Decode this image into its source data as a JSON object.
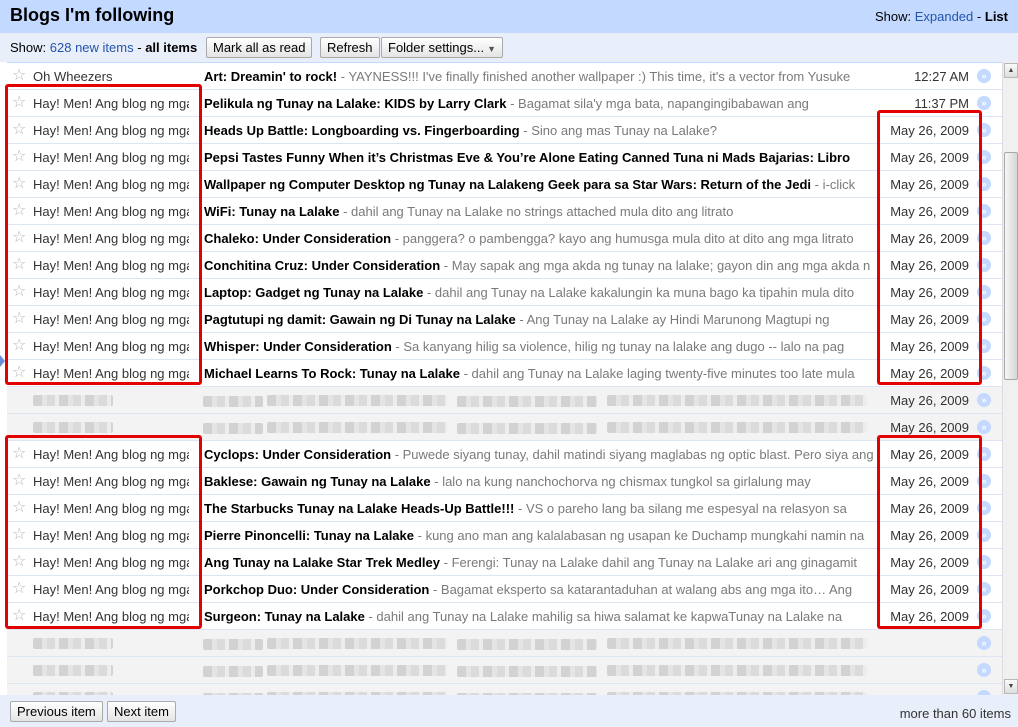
{
  "header": {
    "title": "Blogs I'm following",
    "show_label": "Show:",
    "expanded_label": "Expanded",
    "separator": "-",
    "list_label": "List"
  },
  "toolbar": {
    "show_label": "Show:",
    "new_items": "628 new items",
    "separator": "-",
    "all_items": "all items",
    "mark_all_read": "Mark all as read",
    "refresh": "Refresh",
    "folder_settings": "Folder settings...",
    "folder_settings_arrow": "▼"
  },
  "rows": [
    {
      "source": "Oh Wheezers",
      "title": "Art: Dreamin' to rock!",
      "snippet": "YAYNESS!!! I've finally finished another wallpaper :) This time, it's a vector from Yusuke",
      "date": "12:27 AM",
      "read": false,
      "star": "☆"
    },
    {
      "source": "Hay! Men! Ang blog ng mga",
      "title": "Pelikula ng Tunay na Lalake: KIDS by Larry Clark",
      "snippet": "Bagamat sila'y mga bata, napangingibabawan ang",
      "date": "11:37 PM",
      "read": false,
      "star": "☆"
    },
    {
      "source": "Hay! Men! Ang blog ng mga",
      "title": "Heads Up Battle: Longboarding vs. Fingerboarding",
      "snippet": "Sino ang mas Tunay na Lalake?",
      "date": "May 26, 2009",
      "read": false,
      "star": "☆"
    },
    {
      "source": "Hay! Men! Ang blog ng mga",
      "title": "Pepsi Tastes Funny When it’s Christmas Eve & You’re Alone Eating Canned Tuna ni Mads Bajarias: Libro",
      "snippet": "",
      "date": "May 26, 2009",
      "read": false,
      "star": "☆"
    },
    {
      "source": "Hay! Men! Ang blog ng mga",
      "title": "Wallpaper ng Computer Desktop ng Tunay na Lalakeng Geek para sa Star Wars: Return of the Jedi",
      "snippet": "i-click",
      "date": "May 26, 2009",
      "read": false,
      "star": "☆"
    },
    {
      "source": "Hay! Men! Ang blog ng mga",
      "title": "WiFi: Tunay na Lalake",
      "snippet": "dahil ang Tunay na Lalake no strings attached mula dito ang litrato",
      "date": "May 26, 2009",
      "read": false,
      "star": "☆"
    },
    {
      "source": "Hay! Men! Ang blog ng mga",
      "title": "Chaleko: Under Consideration",
      "snippet": "panggera? o pambengga? kayo ang humusga mula dito at dito ang mga litrato",
      "date": "May 26, 2009",
      "read": false,
      "star": "☆"
    },
    {
      "source": "Hay! Men! Ang blog ng mga",
      "title": "Conchitina Cruz: Under Consideration",
      "snippet": "May sapak ang mga akda ng tunay na lalake; gayon din ang mga akda n",
      "date": "May 26, 2009",
      "read": false,
      "star": "☆"
    },
    {
      "source": "Hay! Men! Ang blog ng mga",
      "title": "Laptop: Gadget ng Tunay na Lalake",
      "snippet": "dahil ang Tunay na Lalake kakalungin ka muna bago ka tipahin mula dito",
      "date": "May 26, 2009",
      "read": false,
      "star": "☆"
    },
    {
      "source": "Hay! Men! Ang blog ng mga",
      "title": "Pagtutupi ng damit: Gawain ng Di Tunay na Lalake",
      "snippet": "Ang Tunay na Lalake ay Hindi Marunong Magtupi ng",
      "date": "May 26, 2009",
      "read": false,
      "star": "☆"
    },
    {
      "source": "Hay! Men! Ang blog ng mga",
      "title": "Whisper: Under Consideration",
      "snippet": "Sa kanyang hilig sa violence, hilig ng tunay na lalake ang dugo -- lalo na pag",
      "date": "May 26, 2009",
      "read": false,
      "star": "☆"
    },
    {
      "source": "Hay! Men! Ang blog ng mga",
      "title": "Michael Learns To Rock: Tunay na Lalake",
      "snippet": "dahil ang Tunay na Lalake laging twenty-five minutes too late mula",
      "date": "May 26, 2009",
      "read": false,
      "star": "☆"
    },
    {
      "source": "",
      "title": "",
      "snippet": "",
      "date": "May 26, 2009",
      "read": true,
      "blurred": true,
      "star": ""
    },
    {
      "source": "",
      "title": "",
      "snippet": "",
      "date": "May 26, 2009",
      "read": true,
      "blurred": true,
      "star": ""
    },
    {
      "source": "Hay! Men! Ang blog ng mga",
      "title": "Cyclops: Under Consideration",
      "snippet": "Puwede siyang tunay, dahil matindi siyang maglabas ng optic blast. Pero siya ang",
      "date": "May 26, 2009",
      "read": false,
      "star": "☆"
    },
    {
      "source": "Hay! Men! Ang blog ng mga",
      "title": "Baklese: Gawain ng Tunay na Lalake",
      "snippet": "lalo na kung nanchochorva ng chismax tungkol sa girlalung may",
      "date": "May 26, 2009",
      "read": false,
      "star": "☆"
    },
    {
      "source": "Hay! Men! Ang blog ng mga",
      "title": "The Starbucks Tunay na Lalake Heads-Up Battle!!!",
      "snippet": "VS o pareho lang ba silang me espesyal na relasyon sa",
      "date": "May 26, 2009",
      "read": false,
      "star": "☆"
    },
    {
      "source": "Hay! Men! Ang blog ng mga",
      "title": "Pierre Pinoncelli: Tunay na Lalake",
      "snippet": "kung ano man ang kalalabasan ng usapan ke Duchamp mungkahi namin na",
      "date": "May 26, 2009",
      "read": false,
      "star": "☆"
    },
    {
      "source": "Hay! Men! Ang blog ng mga",
      "title": "Ang Tunay na Lalake Star Trek Medley",
      "snippet": "Ferengi: Tunay na Lalake dahil ang Tunay na Lalake ari ang ginagamit",
      "date": "May 26, 2009",
      "read": false,
      "star": "☆"
    },
    {
      "source": "Hay! Men! Ang blog ng mga",
      "title": "Porkchop Duo: Under Consideration",
      "snippet": "Bagamat eksperto sa katarantaduhan at walang abs ang mga ito… Ang",
      "date": "May 26, 2009",
      "read": false,
      "star": "☆"
    },
    {
      "source": "Hay! Men! Ang blog ng mga",
      "title": "Surgeon: Tunay na Lalake",
      "snippet": "dahil ang Tunay na Lalake mahilig sa hiwa salamat ke kapwaTunay na Lalake na",
      "date": "May 26, 2009",
      "read": false,
      "star": "☆"
    },
    {
      "source": "",
      "title": "",
      "snippet": "",
      "date": "",
      "read": true,
      "blurred": true,
      "star": ""
    },
    {
      "source": "",
      "title": "",
      "snippet": "",
      "date": "",
      "read": true,
      "blurred": true,
      "star": ""
    },
    {
      "source": "",
      "title": "",
      "snippet": "",
      "date": "",
      "read": true,
      "blurred": true,
      "star": ""
    }
  ],
  "footer": {
    "previous_item": "Previous item",
    "next_item": "Next item",
    "count": "more than 60 items"
  },
  "scrollbar": {
    "up_arrow": "▲",
    "down_arrow": "▼"
  },
  "colors": {
    "header_bg": "#c3d9ff",
    "toolbar_bg": "#e8eefa",
    "link": "#2255aa",
    "annotation": "#e30000"
  },
  "icons": {
    "star": "star-icon",
    "open": "open-entry-icon",
    "dropdown": "chevron-down-icon"
  }
}
